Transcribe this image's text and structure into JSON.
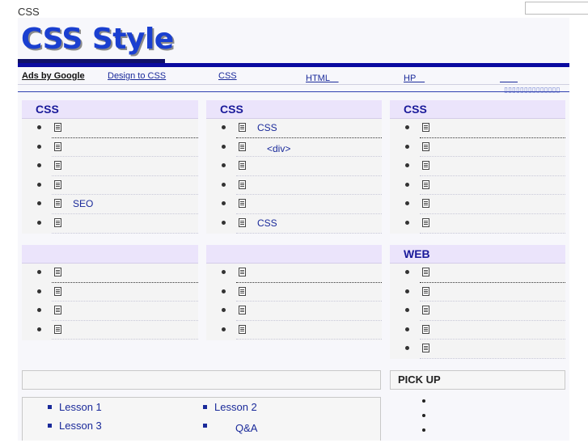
{
  "header": {
    "top_label": "CSS",
    "logo_text": "CSS Style"
  },
  "adbar": {
    "ads_label": "Ads by Google",
    "links": [
      "Design to CSS",
      "CSS",
      "HTML　",
      "HP　",
      "　　"
    ],
    "tiny_icons": "▯▯▯▯▯▯▯▯▯▯▯▯▯▯"
  },
  "boxes": [
    {
      "title": "CSS",
      "items": [
        "",
        "",
        "",
        "",
        "SEO",
        ""
      ]
    },
    {
      "title": "CSS",
      "items": [
        "CSS",
        "　<div>",
        "",
        "",
        "",
        "CSS"
      ]
    },
    {
      "title": "CSS",
      "items": [
        "",
        "",
        "",
        "",
        "",
        ""
      ]
    },
    {
      "title": "",
      "items": [
        "",
        "",
        "",
        ""
      ]
    },
    {
      "title": "",
      "items": [
        "",
        "",
        "",
        ""
      ]
    },
    {
      "title": "WEB",
      "items": [
        "",
        "",
        "",
        "",
        ""
      ]
    }
  ],
  "pickup": {
    "title": "PICK UP",
    "item_count": 3
  },
  "lessons": {
    "items": [
      "Lesson 1",
      "Lesson 2",
      "Lesson 3",
      "　　Q&A"
    ]
  }
}
